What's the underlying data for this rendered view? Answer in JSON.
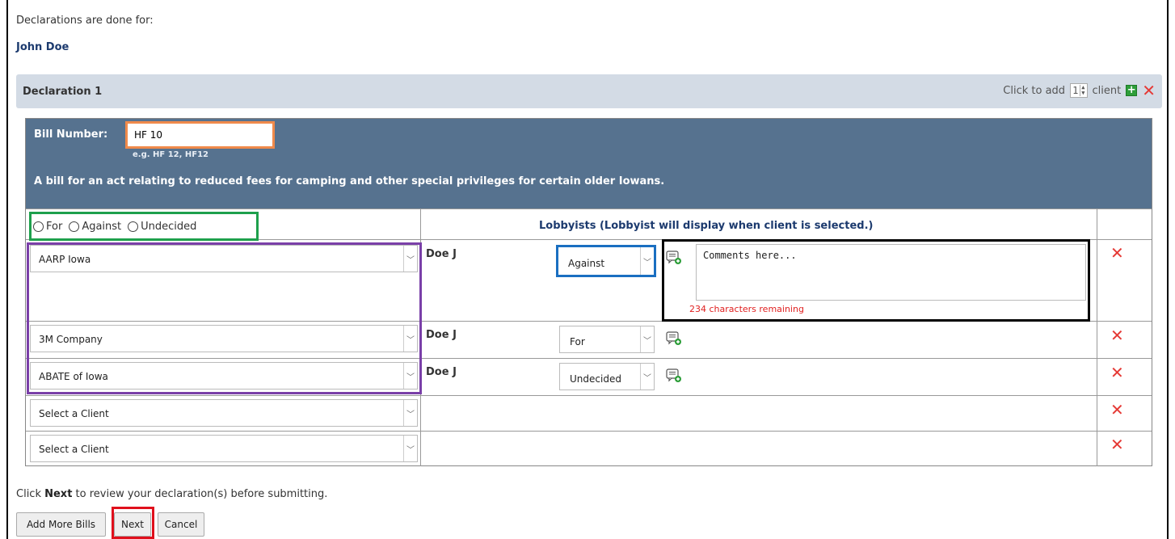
{
  "intro_text": "Declarations are done for:",
  "person_name": "John Doe",
  "declaration": {
    "title": "Declaration 1",
    "add_prefix": "Click to add",
    "add_count": "1",
    "add_suffix": "client"
  },
  "bill": {
    "label": "Bill Number:",
    "value": "HF 10",
    "hint": "e.g. HF 12, HF12",
    "description": "A bill for an act relating to reduced fees for camping and other special privileges for certain older Iowans."
  },
  "position_options": {
    "for": "For",
    "against": "Against",
    "undecided": "Undecided"
  },
  "lobbyists_header": "Lobbyists (Lobbyist will display when client is selected.)",
  "rows": [
    {
      "client": "AARP Iowa",
      "lobbyist": "Doe J",
      "position": "Against",
      "comment_placeholder": "Comments here...",
      "chars_remaining": "234 characters remaining"
    },
    {
      "client": "3M Company",
      "lobbyist": "Doe J",
      "position": "For"
    },
    {
      "client": "ABATE of Iowa",
      "lobbyist": "Doe J",
      "position": "Undecided"
    },
    {
      "client": "Select a Client"
    },
    {
      "client": "Select a Client"
    }
  ],
  "footer": {
    "hint_prefix": "Click ",
    "hint_bold": "Next",
    "hint_suffix": " to review your declaration(s) before submitting.",
    "add_more": "Add More Bills",
    "next": "Next",
    "cancel": "Cancel"
  },
  "colors": {
    "bill_panel": "#56728f",
    "declaration_bar": "#d3dbe5",
    "delete": "#e53935",
    "add": "#2e9e3a"
  }
}
